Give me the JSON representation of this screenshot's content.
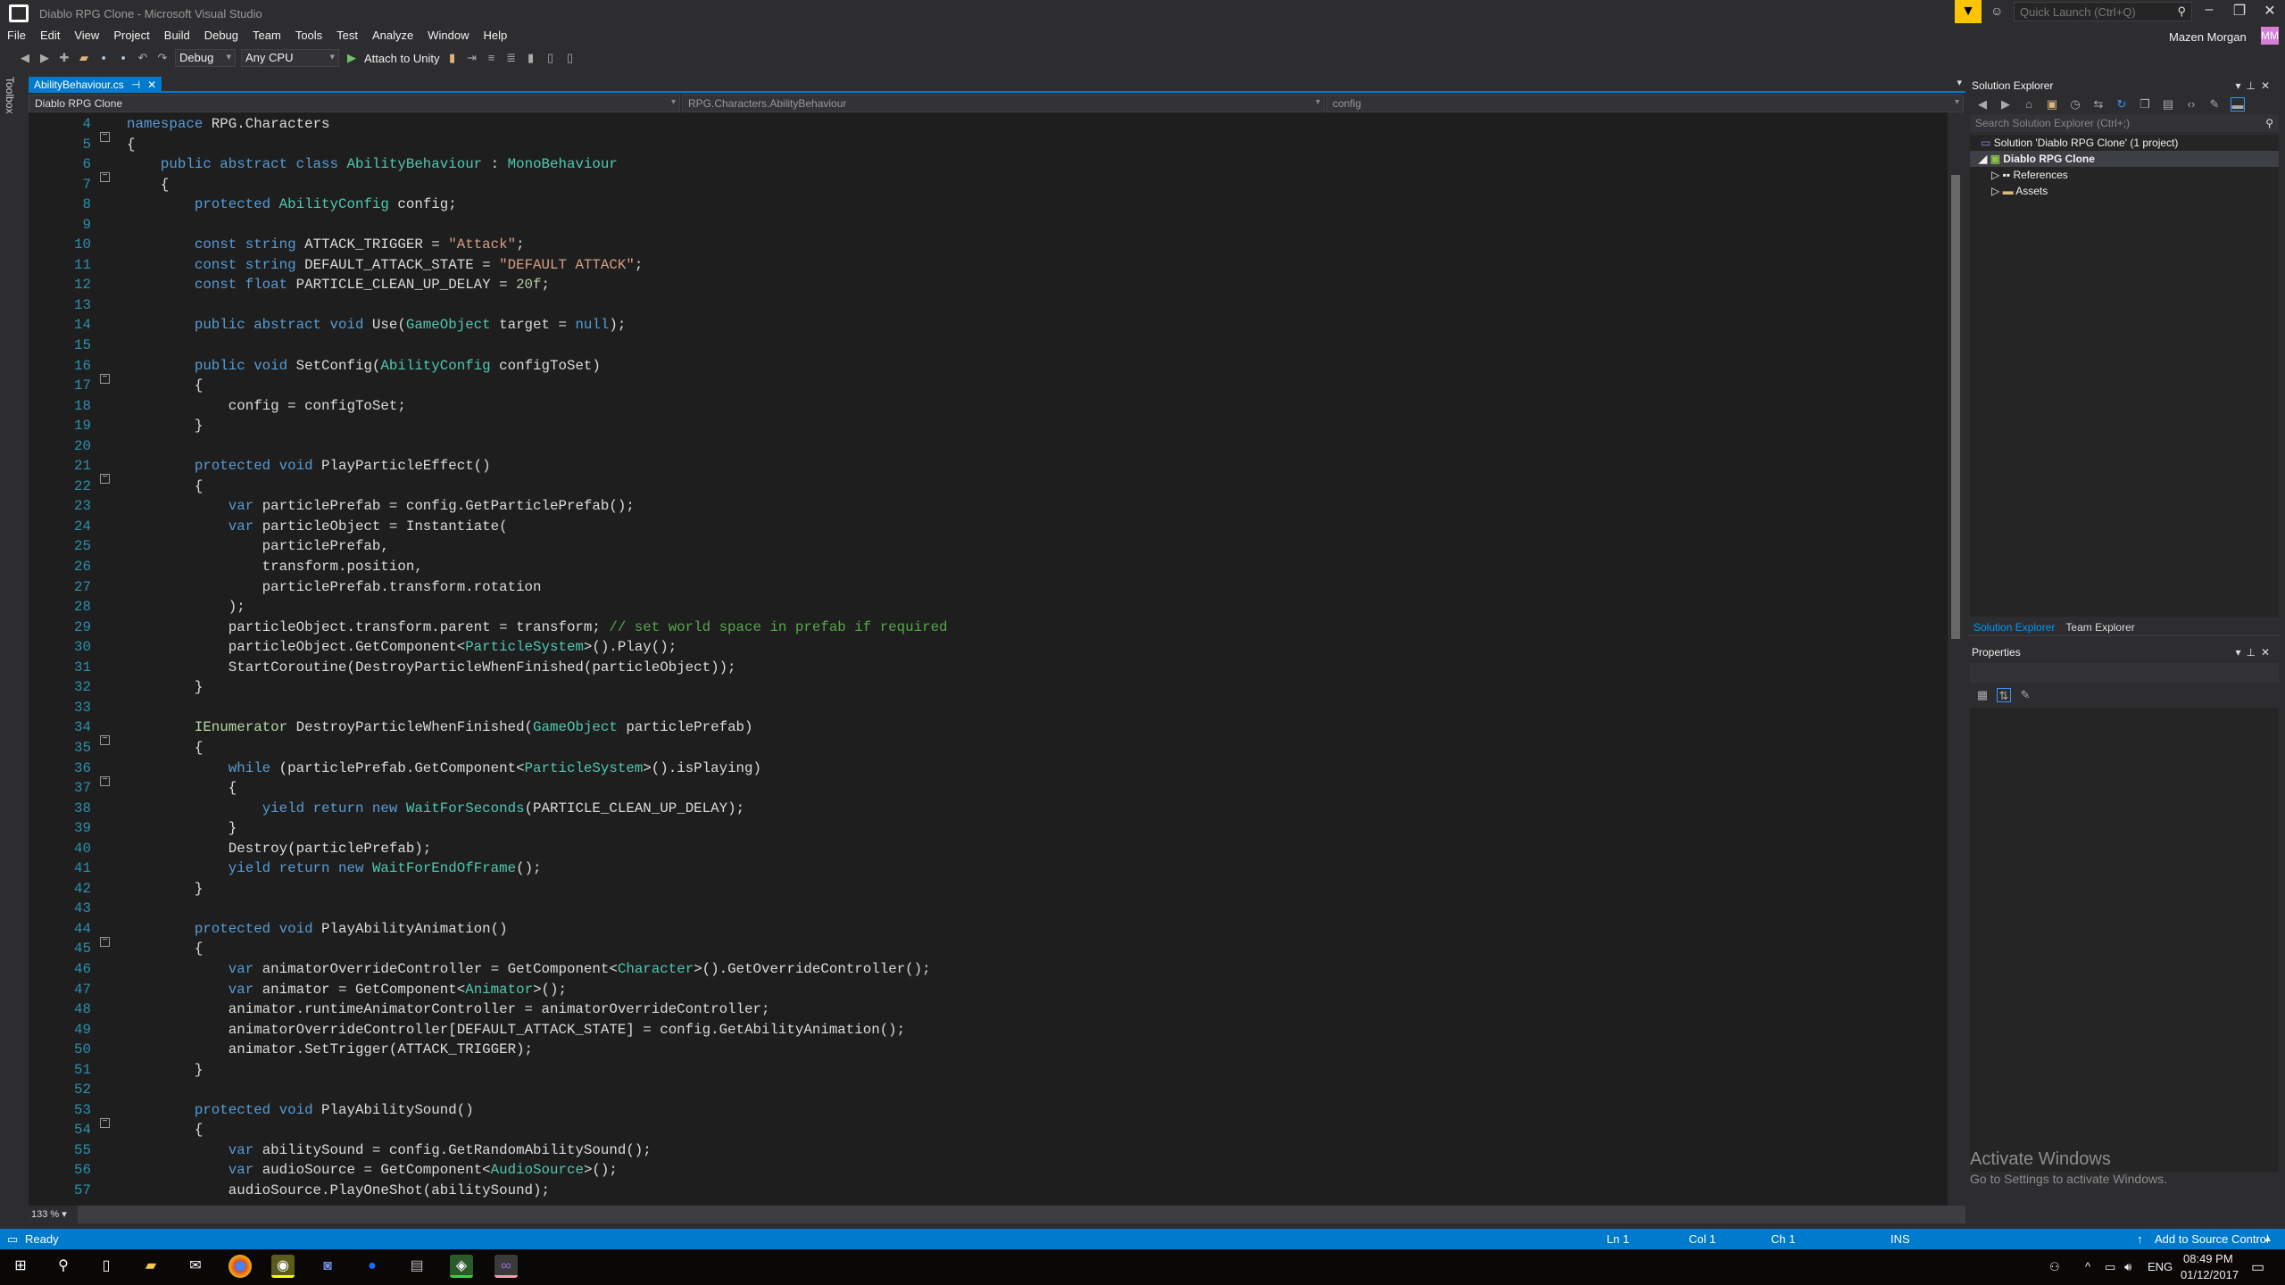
{
  "window": {
    "title": "Diablo RPG Clone - Microsoft Visual Studio",
    "quick_launch_placeholder": "Quick Launch (Ctrl+Q)",
    "user": "Mazen Morgan",
    "avatar_initials": "MM",
    "filter_icon": "funnel-icon"
  },
  "menu": [
    "File",
    "Edit",
    "View",
    "Project",
    "Build",
    "Debug",
    "Team",
    "Tools",
    "Test",
    "Analyze",
    "Window",
    "Help"
  ],
  "toolbar": {
    "config": "Debug",
    "platform": "Any CPU",
    "attach": "Attach to Unity"
  },
  "toolbox_label": "Toolbox",
  "tab": {
    "label": "AbilityBehaviour.cs"
  },
  "navbar": {
    "project": "Diablo RPG Clone",
    "type": "RPG.Characters.AbilityBehaviour",
    "member": "config"
  },
  "code": [
    {
      "n": "4",
      "f": true,
      "t": [
        [
          "k",
          "namespace"
        ],
        [
          "p",
          " RPG.Characters"
        ]
      ]
    },
    {
      "n": "5",
      "t": [
        [
          "p",
          "{"
        ]
      ]
    },
    {
      "n": "6",
      "f": true,
      "t": [
        [
          "p",
          "    "
        ],
        [
          "k",
          "public abstract class"
        ],
        [
          "p",
          " "
        ],
        [
          "t",
          "AbilityBehaviour"
        ],
        [
          "p",
          " : "
        ],
        [
          "t",
          "MonoBehaviour"
        ]
      ]
    },
    {
      "n": "7",
      "t": [
        [
          "p",
          "    {"
        ]
      ]
    },
    {
      "n": "8",
      "t": [
        [
          "p",
          "        "
        ],
        [
          "k",
          "protected"
        ],
        [
          "p",
          " "
        ],
        [
          "t",
          "AbilityConfig"
        ],
        [
          "p",
          " config;"
        ]
      ]
    },
    {
      "n": "9",
      "t": []
    },
    {
      "n": "10",
      "t": [
        [
          "p",
          "        "
        ],
        [
          "k",
          "const string"
        ],
        [
          "p",
          " ATTACK_TRIGGER = "
        ],
        [
          "s",
          "\"Attack\""
        ],
        [
          "p",
          ";"
        ]
      ]
    },
    {
      "n": "11",
      "t": [
        [
          "p",
          "        "
        ],
        [
          "k",
          "const string"
        ],
        [
          "p",
          " DEFAULT_ATTACK_STATE = "
        ],
        [
          "s",
          "\"DEFAULT ATTACK\""
        ],
        [
          "p",
          ";"
        ]
      ]
    },
    {
      "n": "12",
      "t": [
        [
          "p",
          "        "
        ],
        [
          "k",
          "const float"
        ],
        [
          "p",
          " PARTICLE_CLEAN_UP_DELAY = "
        ],
        [
          "n",
          "20f"
        ],
        [
          "p",
          ";"
        ]
      ]
    },
    {
      "n": "13",
      "t": []
    },
    {
      "n": "14",
      "t": [
        [
          "p",
          "        "
        ],
        [
          "k",
          "public abstract void"
        ],
        [
          "p",
          " Use("
        ],
        [
          "t",
          "GameObject"
        ],
        [
          "p",
          " target = "
        ],
        [
          "k",
          "null"
        ],
        [
          "p",
          ");"
        ]
      ]
    },
    {
      "n": "15",
      "t": []
    },
    {
      "n": "16",
      "f": true,
      "t": [
        [
          "p",
          "        "
        ],
        [
          "k",
          "public void"
        ],
        [
          "p",
          " SetConfig("
        ],
        [
          "t",
          "AbilityConfig"
        ],
        [
          "p",
          " configToSet)"
        ]
      ]
    },
    {
      "n": "17",
      "t": [
        [
          "p",
          "        {"
        ]
      ]
    },
    {
      "n": "18",
      "t": [
        [
          "p",
          "            config = configToSet;"
        ]
      ]
    },
    {
      "n": "19",
      "t": [
        [
          "p",
          "        }"
        ]
      ]
    },
    {
      "n": "20",
      "t": []
    },
    {
      "n": "21",
      "f": true,
      "t": [
        [
          "p",
          "        "
        ],
        [
          "k",
          "protected void"
        ],
        [
          "p",
          " PlayParticleEffect()"
        ]
      ]
    },
    {
      "n": "22",
      "t": [
        [
          "p",
          "        {"
        ]
      ]
    },
    {
      "n": "23",
      "t": [
        [
          "p",
          "            "
        ],
        [
          "k",
          "var"
        ],
        [
          "p",
          " particlePrefab = config.GetParticlePrefab();"
        ]
      ]
    },
    {
      "n": "24",
      "t": [
        [
          "p",
          "            "
        ],
        [
          "k",
          "var"
        ],
        [
          "p",
          " particleObject = Instantiate("
        ]
      ]
    },
    {
      "n": "25",
      "t": [
        [
          "p",
          "                particlePrefab,"
        ]
      ]
    },
    {
      "n": "26",
      "t": [
        [
          "p",
          "                transform.position,"
        ]
      ]
    },
    {
      "n": "27",
      "t": [
        [
          "p",
          "                particlePrefab.transform.rotation"
        ]
      ]
    },
    {
      "n": "28",
      "t": [
        [
          "p",
          "            );"
        ]
      ]
    },
    {
      "n": "29",
      "t": [
        [
          "p",
          "            particleObject.transform.parent = transform; "
        ],
        [
          "c",
          "// set world space in prefab if required"
        ]
      ]
    },
    {
      "n": "30",
      "t": [
        [
          "p",
          "            particleObject.GetComponent<"
        ],
        [
          "t",
          "ParticleSystem"
        ],
        [
          "p",
          ">().Play();"
        ]
      ]
    },
    {
      "n": "31",
      "t": [
        [
          "p",
          "            StartCoroutine(DestroyParticleWhenFinished(particleObject));"
        ]
      ]
    },
    {
      "n": "32",
      "t": [
        [
          "p",
          "        }"
        ]
      ]
    },
    {
      "n": "33",
      "t": []
    },
    {
      "n": "34",
      "f": true,
      "t": [
        [
          "p",
          "        "
        ],
        [
          "i",
          "IEnumerator"
        ],
        [
          "p",
          " DestroyParticleWhenFinished("
        ],
        [
          "t",
          "GameObject"
        ],
        [
          "p",
          " particlePrefab)"
        ]
      ]
    },
    {
      "n": "35",
      "t": [
        [
          "p",
          "        {"
        ]
      ]
    },
    {
      "n": "36",
      "f": true,
      "t": [
        [
          "p",
          "            "
        ],
        [
          "k",
          "while"
        ],
        [
          "p",
          " (particlePrefab.GetComponent<"
        ],
        [
          "t",
          "ParticleSystem"
        ],
        [
          "p",
          ">().isPlaying)"
        ]
      ]
    },
    {
      "n": "37",
      "t": [
        [
          "p",
          "            {"
        ]
      ]
    },
    {
      "n": "38",
      "t": [
        [
          "p",
          "                "
        ],
        [
          "k",
          "yield return new"
        ],
        [
          "p",
          " "
        ],
        [
          "t",
          "WaitForSeconds"
        ],
        [
          "p",
          "(PARTICLE_CLEAN_UP_DELAY);"
        ]
      ]
    },
    {
      "n": "39",
      "t": [
        [
          "p",
          "            }"
        ]
      ]
    },
    {
      "n": "40",
      "t": [
        [
          "p",
          "            Destroy(particlePrefab);"
        ]
      ]
    },
    {
      "n": "41",
      "t": [
        [
          "p",
          "            "
        ],
        [
          "k",
          "yield return new"
        ],
        [
          "p",
          " "
        ],
        [
          "t",
          "WaitForEndOfFrame"
        ],
        [
          "p",
          "();"
        ]
      ]
    },
    {
      "n": "42",
      "t": [
        [
          "p",
          "        }"
        ]
      ]
    },
    {
      "n": "43",
      "t": []
    },
    {
      "n": "44",
      "f": true,
      "t": [
        [
          "p",
          "        "
        ],
        [
          "k",
          "protected void"
        ],
        [
          "p",
          " PlayAbilityAnimation()"
        ]
      ]
    },
    {
      "n": "45",
      "t": [
        [
          "p",
          "        {"
        ]
      ]
    },
    {
      "n": "46",
      "t": [
        [
          "p",
          "            "
        ],
        [
          "k",
          "var"
        ],
        [
          "p",
          " animatorOverrideController = GetComponent<"
        ],
        [
          "t",
          "Character"
        ],
        [
          "p",
          ">().GetOverrideController();"
        ]
      ]
    },
    {
      "n": "47",
      "t": [
        [
          "p",
          "            "
        ],
        [
          "k",
          "var"
        ],
        [
          "p",
          " animator = GetComponent<"
        ],
        [
          "t",
          "Animator"
        ],
        [
          "p",
          ">();"
        ]
      ]
    },
    {
      "n": "48",
      "t": [
        [
          "p",
          "            animator.runtimeAnimatorController = animatorOverrideController;"
        ]
      ]
    },
    {
      "n": "49",
      "t": [
        [
          "p",
          "            animatorOverrideController[DEFAULT_ATTACK_STATE] = config.GetAbilityAnimation();"
        ]
      ]
    },
    {
      "n": "50",
      "t": [
        [
          "p",
          "            animator.SetTrigger(ATTACK_TRIGGER);"
        ]
      ]
    },
    {
      "n": "51",
      "t": [
        [
          "p",
          "        }"
        ]
      ]
    },
    {
      "n": "52",
      "t": []
    },
    {
      "n": "53",
      "f": true,
      "t": [
        [
          "p",
          "        "
        ],
        [
          "k",
          "protected void"
        ],
        [
          "p",
          " PlayAbilitySound()"
        ]
      ]
    },
    {
      "n": "54",
      "t": [
        [
          "p",
          "        {"
        ]
      ]
    },
    {
      "n": "55",
      "t": [
        [
          "p",
          "            "
        ],
        [
          "k",
          "var"
        ],
        [
          "p",
          " abilitySound = config.GetRandomAbilitySound();"
        ]
      ]
    },
    {
      "n": "56",
      "t": [
        [
          "p",
          "            "
        ],
        [
          "k",
          "var"
        ],
        [
          "p",
          " audioSource = GetComponent<"
        ],
        [
          "t",
          "AudioSource"
        ],
        [
          "p",
          ">();"
        ]
      ]
    },
    {
      "n": "57",
      "t": [
        [
          "p",
          "            audioSource.PlayOneShot(abilitySound);"
        ]
      ]
    }
  ],
  "zoom": "133 %",
  "solution_explorer": {
    "title": "Solution Explorer",
    "search_placeholder": "Search Solution Explorer (Ctrl+;)",
    "solution": "Solution 'Diablo RPG Clone' (1 project)",
    "project": "Diablo RPG Clone",
    "items": [
      "References",
      "Assets"
    ],
    "tabs": [
      "Solution Explorer",
      "Team Explorer"
    ]
  },
  "properties": {
    "title": "Properties"
  },
  "activate": {
    "title": "Activate Windows",
    "subtitle": "Go to Settings to activate Windows."
  },
  "status": {
    "ready": "Ready",
    "ln": "Ln 1",
    "col": "Col 1",
    "ch": "Ch 1",
    "ins": "INS",
    "source_control": "Add to Source Control"
  },
  "taskbar": {
    "lang": "ENG",
    "time": "08:49 PM",
    "date": "01/12/2017"
  },
  "colors": {
    "accent": "#007acc",
    "keyword": "#569cd6",
    "type": "#4ec9b0",
    "string": "#d69d85",
    "comment": "#57a64a",
    "line_number": "#2b91af"
  }
}
